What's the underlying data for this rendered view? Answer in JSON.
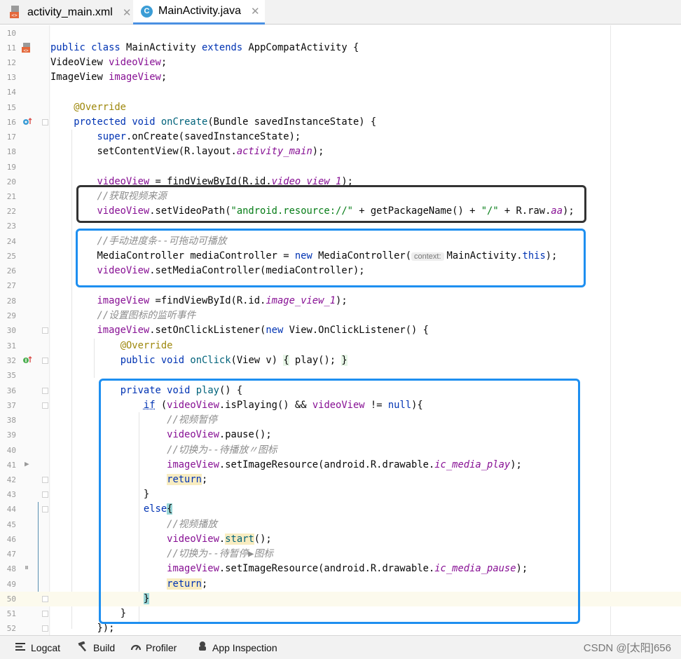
{
  "tabs": [
    {
      "label": "activity_main.xml",
      "icon": "xml-file-icon",
      "active": false
    },
    {
      "label": "MainActivity.java",
      "icon": "java-class-icon",
      "active": true
    }
  ],
  "editor": {
    "lines": [
      {
        "n": "10"
      },
      {
        "n": "11"
      },
      {
        "n": "12"
      },
      {
        "n": "13"
      },
      {
        "n": "14"
      },
      {
        "n": "15"
      },
      {
        "n": "16"
      },
      {
        "n": "17"
      },
      {
        "n": "18"
      },
      {
        "n": "19"
      },
      {
        "n": "20"
      },
      {
        "n": "21"
      },
      {
        "n": "22"
      },
      {
        "n": "23"
      },
      {
        "n": "24"
      },
      {
        "n": "25"
      },
      {
        "n": "26"
      },
      {
        "n": "27"
      },
      {
        "n": "28"
      },
      {
        "n": "29"
      },
      {
        "n": "30"
      },
      {
        "n": "31"
      },
      {
        "n": "32"
      },
      {
        "n": "35"
      },
      {
        "n": "36"
      },
      {
        "n": "37"
      },
      {
        "n": "38"
      },
      {
        "n": "39"
      },
      {
        "n": "40"
      },
      {
        "n": "41"
      },
      {
        "n": "42"
      },
      {
        "n": "43"
      },
      {
        "n": "44"
      },
      {
        "n": "45"
      },
      {
        "n": "46"
      },
      {
        "n": "47"
      },
      {
        "n": "48"
      },
      {
        "n": "49"
      },
      {
        "n": "50"
      },
      {
        "n": "51"
      },
      {
        "n": "52"
      }
    ],
    "code": {
      "l11": {
        "a": "public",
        "b": "class",
        "c": " MainActivity ",
        "d": "extends",
        "e": " AppCompatActivity {"
      },
      "l12": {
        "a": "VideoView ",
        "b": "videoView",
        "c": ";"
      },
      "l13": {
        "a": "ImageView ",
        "b": "imageView",
        "c": ";"
      },
      "l15": {
        "a": "@Override"
      },
      "l16": {
        "a": "protected",
        "b": "void",
        "c": "onCreate",
        "d": "(Bundle savedInstanceState) {"
      },
      "l17": {
        "a": "super",
        "b": ".onCreate(savedInstanceState);"
      },
      "l18": {
        "a": "setContentView(R.layout.",
        "b": "activity_main",
        "c": ");"
      },
      "l20": {
        "a": "videoView",
        "b": " = findViewById(R.id.",
        "c": "video_view_1",
        "d": ");"
      },
      "l21": {
        "a": "//获取视频来源"
      },
      "l22": {
        "a": "videoView",
        "b": ".setVideoPath(",
        "c": "\"android.resource://\"",
        "d": " + getPackageName() + ",
        "e": "\"/\"",
        "f": " + R.raw.",
        "g": "aa",
        "h": ");"
      },
      "l24": {
        "a": "//手动进度条--可拖动可播放"
      },
      "l25": {
        "a": "MediaController mediaController = ",
        "b": "new",
        "c": " MediaController(",
        "hint": "context:",
        "d": "MainActivity.",
        "e": "this",
        "f": ");"
      },
      "l26": {
        "a": "videoView",
        "b": ".setMediaController(mediaController);"
      },
      "l28": {
        "a": "imageView",
        "b": " =findViewById(R.id.",
        "c": "image_view_1",
        "d": ");"
      },
      "l29": {
        "a": "//设置图标的监听事件"
      },
      "l30": {
        "a": "imageView",
        "b": ".setOnClickListener(",
        "c": "new",
        "d": " View.OnClickListener() {"
      },
      "l31": {
        "a": "@Override"
      },
      "l32": {
        "a": "public",
        "b": "void",
        "c": "onClick",
        "d": "(View v) ",
        "e": "{",
        "f": " play(); ",
        "g": "}"
      },
      "l36": {
        "a": "private",
        "b": "void",
        "c": "play",
        "d": "() {"
      },
      "l37": {
        "a": "if",
        "b": " (",
        "c": "videoView",
        "d": ".isPlaying() && ",
        "e": "videoView",
        "f": " != ",
        "g": "null",
        "h": "){"
      },
      "l38": {
        "a": "//视频暂停"
      },
      "l39": {
        "a": "videoView",
        "b": ".pause();"
      },
      "l40": {
        "a": "//切换为--待播放〃图标"
      },
      "l41": {
        "a": "imageView",
        "b": ".setImageResource(android.R.drawable.",
        "c": "ic_media_play",
        "d": ");"
      },
      "l42": {
        "a": "return",
        "b": ";"
      },
      "l43": {
        "a": "}"
      },
      "l44": {
        "a": "else",
        "b": "{"
      },
      "l45": {
        "a": "//视频播放"
      },
      "l46": {
        "a": "videoView",
        "b": ".",
        "c": "start",
        "d": "();"
      },
      "l47": {
        "a": "//切换为--待暂停▶图标"
      },
      "l48": {
        "a": "imageView",
        "b": ".setImageResource(android.R.drawable.",
        "c": "ic_media_pause",
        "d": ");"
      },
      "l49": {
        "a": "return",
        "b": ";"
      },
      "l50": {
        "a": "}"
      },
      "l51": {
        "a": "}"
      },
      "l52": {
        "a": "});"
      }
    }
  },
  "bottom_tools": [
    {
      "label": "Logcat",
      "icon": "logcat-icon"
    },
    {
      "label": "Build",
      "icon": "hammer-icon"
    },
    {
      "label": "Profiler",
      "icon": "gauge-icon"
    },
    {
      "label": "App Inspection",
      "icon": "inspection-icon"
    }
  ],
  "watermark": "CSDN @[太阳]656",
  "colors": {
    "keyword": "#0033b3",
    "field": "#871094",
    "method": "#00627a",
    "string": "#067d17",
    "comment": "#8c8c8c",
    "annotation": "#9e880d",
    "highlight_box": "#1e8ff0",
    "dark_box": "#333333"
  }
}
